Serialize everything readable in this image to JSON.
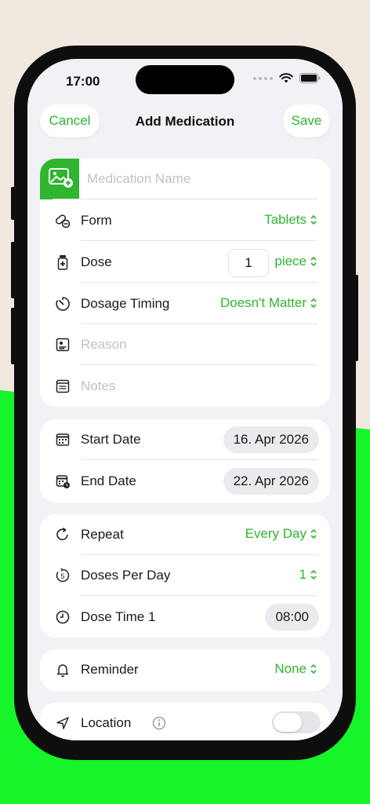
{
  "status_bar": {
    "time": "17:00"
  },
  "nav": {
    "cancel_label": "Cancel",
    "title": "Add Medication",
    "save_label": "Save"
  },
  "medication": {
    "name_placeholder": "Medication Name",
    "form": {
      "label": "Form",
      "value": "Tablets"
    },
    "dose": {
      "label": "Dose",
      "amount": "1",
      "unit": "piece"
    },
    "timing": {
      "label": "Dosage Timing",
      "value": "Doesn't Matter"
    },
    "reason_placeholder": "Reason",
    "notes_placeholder": "Notes"
  },
  "dates": {
    "start": {
      "label": "Start Date",
      "value": "16. Apr 2026"
    },
    "end": {
      "label": "End Date",
      "value": "22. Apr 2026"
    }
  },
  "schedule": {
    "repeat": {
      "label": "Repeat",
      "value": "Every Day"
    },
    "doses_per_day": {
      "label": "Doses Per Day",
      "value": "1"
    },
    "dose_time": {
      "label": "Dose Time 1",
      "value": "08:00"
    }
  },
  "reminder": {
    "label": "Reminder",
    "value": "None"
  },
  "location": {
    "label": "Location",
    "toggle_on": false
  },
  "colors": {
    "accent": "#2fb52f",
    "background_green": "#16f52a",
    "background_beige": "#f1e9df"
  },
  "icons": [
    "photo-add-icon",
    "pill-icon",
    "medicine-bottle-icon",
    "timer-icon",
    "id-card-icon",
    "notes-icon",
    "calendar-icon",
    "calendar-clock-icon",
    "repeat-icon",
    "counter-icon",
    "clock-icon",
    "bell-icon",
    "location-arrow-icon",
    "info-icon",
    "wifi-icon",
    "battery-icon"
  ]
}
